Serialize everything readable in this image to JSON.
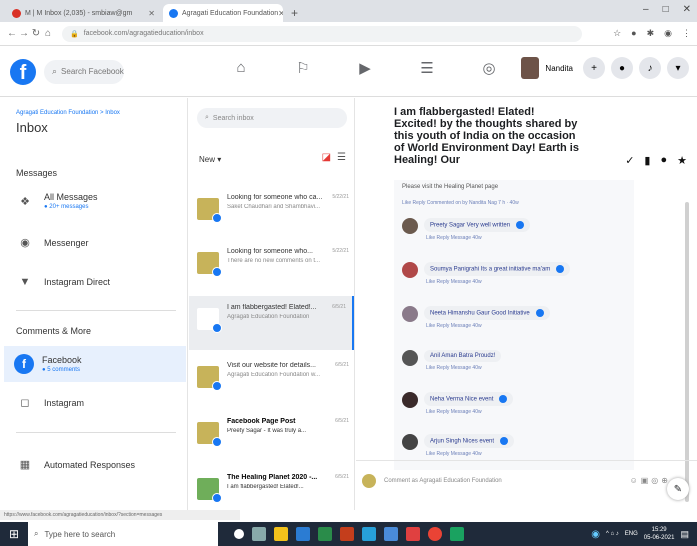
{
  "browser": {
    "tabs": [
      {
        "label": "M | M Inbox (2,035) - smbiaw@gm"
      },
      {
        "label": "Agragati Education Foundation"
      }
    ],
    "new_tab": "+",
    "address": "facebook.com/agragatieducation/inbox",
    "window_controls": [
      "–",
      "□",
      "✕"
    ]
  },
  "fb": {
    "logo": "f",
    "search_placeholder": "Search Facebook",
    "user_name": "Nandita"
  },
  "left": {
    "breadcrumb": "Agragati Education Foundation > Inbox",
    "title": "Inbox",
    "messages_heading": "Messages",
    "all_messages": "All Messages",
    "all_messages_sub": "● 20+ messages",
    "messenger": "Messenger",
    "instagram_direct": "Instagram Direct",
    "comments_heading": "Comments & More",
    "facebook": "Facebook",
    "facebook_sub": "● 5 comments",
    "instagram": "Instagram",
    "automated": "Automated Responses"
  },
  "mid": {
    "search_placeholder": "Search inbox",
    "filter_label": "New ▾",
    "conversations": [
      {
        "title": "Looking for someone who ca...",
        "snippet": "Saket Chaudhari and Shambhavi...",
        "time": "5/22/21"
      },
      {
        "title": "Looking for someone who...",
        "snippet": "There are no new comments on t...",
        "time": "5/22/21"
      },
      {
        "title": "I am flabbergasted! Elated!...",
        "snippet": "Agragati Education Foundation",
        "time": "6/5/21"
      },
      {
        "title": "Visit our website for details...",
        "snippet": "Agragati Education Foundation w...",
        "time": "6/5/21"
      },
      {
        "title": "Facebook Page Post",
        "snippet": "Preety Sagar - It was truly a...",
        "time": "6/5/21"
      },
      {
        "title": "The Healing Planet 2020 -...",
        "snippet": "I am flabbergasted! Elated!...",
        "time": "6/5/21"
      }
    ]
  },
  "right": {
    "post_text": "I am flabbergasted! Elated! Excited! by the thoughts shared by this youth of India on the occasion of World Environment Day! Earth is Healing! Our",
    "first_line": "Please visit the Healing Planet page",
    "first_meta": "Like  Reply  Commented on by Nandita Nag 7 h · 40w",
    "comments": [
      {
        "text": "Preety Sagar Very well written",
        "meta": "Like  Reply  Message  40w",
        "color": "#6b5a4e"
      },
      {
        "text": "Soumya Panigrahi Its a great initiative ma'am",
        "meta": "Like  Reply  Message  40w",
        "color": "#b04848"
      },
      {
        "text": "Neeta Himanshu Gaur Good Initiative",
        "meta": "Like  Reply  Message  40w",
        "color": "#8a7a8a"
      },
      {
        "text": "Anil Aman Batra Proudz!",
        "meta": "Like  Reply  Message  40w",
        "color": "#555555"
      },
      {
        "text": "Neha Verma Nice event",
        "meta": "Like  Reply  Message  40w",
        "color": "#3a2a2a"
      },
      {
        "text": "Arjun Singh Nices event",
        "meta": "Like  Reply  Message  40w",
        "color": "#444444"
      }
    ],
    "composer_placeholder": "Comment as Agragati Education Foundation"
  },
  "status_url": "https://www.facebook.com/agragatieducation/inbox/?section=messages",
  "taskbar": {
    "search_placeholder": "Type here to search",
    "time": "15:29",
    "date": "05-06-2021",
    "lang": "ENG"
  }
}
